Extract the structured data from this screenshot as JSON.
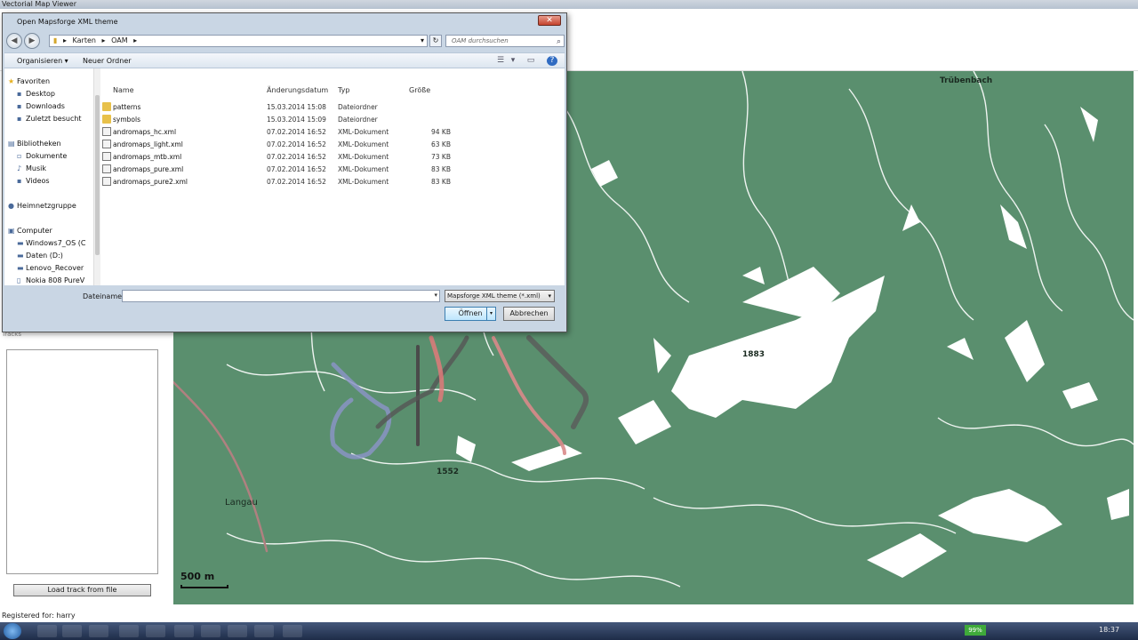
{
  "app": {
    "title": "Vectorial Map Viewer",
    "tracks_header": "Tracks",
    "load_track_label": "Load track from file",
    "registered_label": "Registered for: harry"
  },
  "map": {
    "labels": {
      "peak1": "1883",
      "peak2": "1552",
      "town1": "Langau",
      "town2": "Trübenbach"
    },
    "scale_label": "500 m",
    "colors": {
      "forest": "#5a8f6e",
      "open": "#ffffff",
      "road": "#c9a39b"
    }
  },
  "dialog": {
    "title": "Open Mapsforge XML theme",
    "close_label": "✕",
    "breadcrumb": [
      "Karten",
      "OAM"
    ],
    "search_placeholder": "OAM durchsuchen",
    "organize_label": "Organisieren ▾",
    "new_folder_label": "Neuer Ordner",
    "nav": {
      "favorites": "Favoriten",
      "desktop": "Desktop",
      "downloads": "Downloads",
      "recent": "Zuletzt besucht",
      "libraries": "Bibliotheken",
      "documents": "Dokumente",
      "music": "Musik",
      "videos": "Videos",
      "homegroup": "Heimnetzgruppe",
      "computer": "Computer",
      "drive_c": "Windows7_OS (C",
      "drive_d": "Daten (D:)",
      "recovery": "Lenovo_Recover",
      "nokia": "Nokia 808 PureV"
    },
    "columns": {
      "name": "Name",
      "date": "Änderungsdatum",
      "type": "Typ",
      "size": "Größe"
    },
    "files": [
      {
        "name": "patterns",
        "date": "15.03.2014 15:08",
        "type": "Dateiordner",
        "size": ""
      },
      {
        "name": "symbols",
        "date": "15.03.2014 15:09",
        "type": "Dateiordner",
        "size": ""
      },
      {
        "name": "andromaps_hc.xml",
        "date": "07.02.2014 16:52",
        "type": "XML-Dokument",
        "size": "94 KB"
      },
      {
        "name": "andromaps_light.xml",
        "date": "07.02.2014 16:52",
        "type": "XML-Dokument",
        "size": "63 KB"
      },
      {
        "name": "andromaps_mtb.xml",
        "date": "07.02.2014 16:52",
        "type": "XML-Dokument",
        "size": "73 KB"
      },
      {
        "name": "andromaps_pure.xml",
        "date": "07.02.2014 16:52",
        "type": "XML-Dokument",
        "size": "83 KB"
      },
      {
        "name": "andromaps_pure2.xml",
        "date": "07.02.2014 16:52",
        "type": "XML-Dokument",
        "size": "83 KB"
      }
    ],
    "filename_label": "Dateiname:",
    "filename_value": "",
    "filter_value": "Mapsforge XML theme (*.xml)",
    "open_label": "Öffnen",
    "cancel_label": "Abbrechen"
  },
  "taskbar": {
    "battery": "99%",
    "clock": "18:37"
  }
}
